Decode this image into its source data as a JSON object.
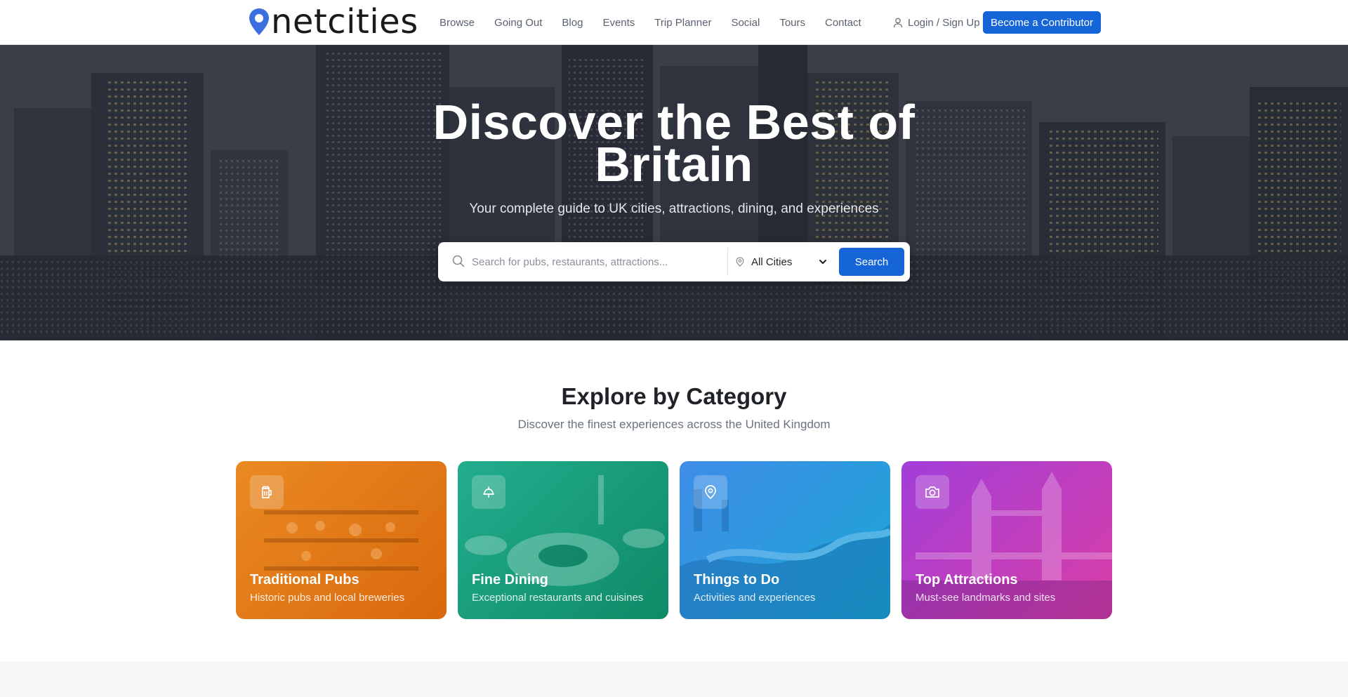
{
  "brand": {
    "name": "netcities",
    "accent": "#1565d8",
    "pin_color": "#3b6fe0"
  },
  "nav": {
    "links": [
      "Browse",
      "Going Out",
      "Blog",
      "Events",
      "Trip Planner",
      "Social",
      "Tours",
      "Contact"
    ],
    "login": "Login / Sign Up",
    "login_icon": "user-icon",
    "cta": "Become a Contributor"
  },
  "hero": {
    "title": "Discover the Best of Britain",
    "subtitle": "Your complete guide to UK cities, attractions, dining, and experiences",
    "search": {
      "placeholder": "Search for pubs, restaurants, attractions...",
      "value": "",
      "city": "All Cities",
      "button": "Search"
    }
  },
  "categories": {
    "title": "Explore by Category",
    "subtitle": "Discover the finest experiences across the United Kingdom",
    "cards": [
      {
        "title": "Traditional Pubs",
        "desc": "Historic pubs and local breweries",
        "icon": "beer-mug-icon",
        "color_from": "#e8861f",
        "color_to": "#d8650a"
      },
      {
        "title": "Fine Dining",
        "desc": "Exceptional restaurants and cuisines",
        "icon": "dining-icon",
        "color_from": "#1fa88a",
        "color_to": "#0d8a66"
      },
      {
        "title": "Things to Do",
        "desc": "Activities and experiences",
        "icon": "location-pin-icon",
        "color_from": "#3b8fe6",
        "color_to": "#1aa3d6"
      },
      {
        "title": "Top Attractions",
        "desc": "Must-see landmarks and sites",
        "icon": "camera-icon",
        "color_from": "#a03fd9",
        "color_to": "#d23ea8"
      }
    ]
  }
}
